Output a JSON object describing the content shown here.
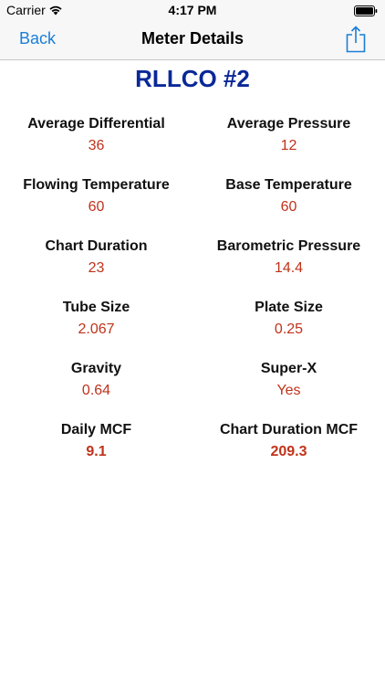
{
  "status_bar": {
    "carrier": "Carrier",
    "time": "4:17 PM"
  },
  "nav": {
    "back_label": "Back",
    "title": "Meter Details",
    "share_icon": "share-icon"
  },
  "meter_name": "RLLCO #2",
  "colors": {
    "accent": "#1a7ed8",
    "title": "#0a2898",
    "value": "#c0321a"
  },
  "fields": {
    "average_differential": {
      "label": "Average Differential",
      "value": "36"
    },
    "average_pressure": {
      "label": "Average Pressure",
      "value": "12"
    },
    "flowing_temperature": {
      "label": "Flowing Temperature",
      "value": "60"
    },
    "base_temperature": {
      "label": "Base Temperature",
      "value": "60"
    },
    "chart_duration": {
      "label": "Chart Duration",
      "value": "23"
    },
    "barometric_pressure": {
      "label": "Barometric Pressure",
      "value": "14.4"
    },
    "tube_size": {
      "label": "Tube Size",
      "value": "2.067"
    },
    "plate_size": {
      "label": "Plate Size",
      "value": "0.25"
    },
    "gravity": {
      "label": "Gravity",
      "value": "0.64"
    },
    "super_x": {
      "label": "Super-X",
      "value": "Yes"
    },
    "daily_mcf": {
      "label": "Daily MCF",
      "value": "9.1"
    },
    "chart_duration_mcf": {
      "label": "Chart Duration MCF",
      "value": "209.3"
    }
  }
}
